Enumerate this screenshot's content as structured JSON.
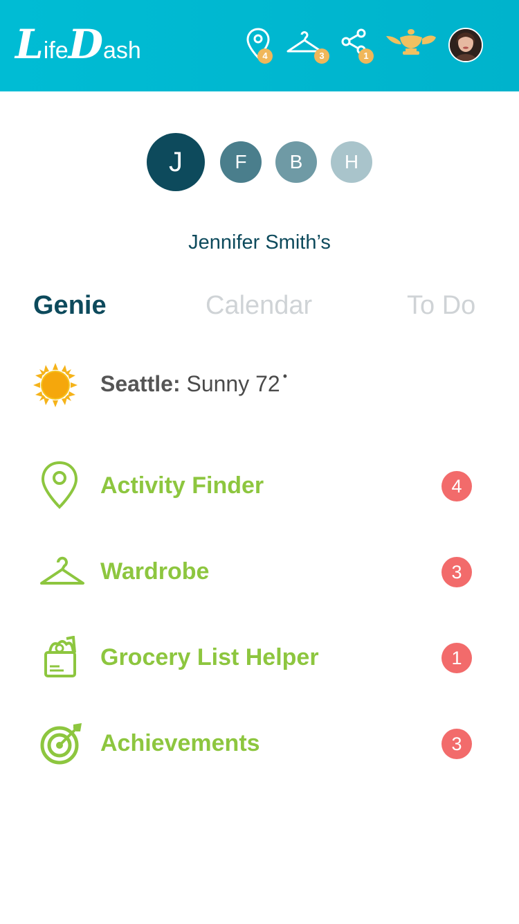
{
  "header": {
    "logo": {
      "big_l": "L",
      "life_rest": "ife",
      "big_d": "D",
      "dash_rest": "ash"
    },
    "icons": [
      {
        "name": "location-pin-icon",
        "badge": "4"
      },
      {
        "name": "hanger-icon",
        "badge": "3"
      },
      {
        "name": "share-icon",
        "badge": "1"
      },
      {
        "name": "genie-lamp-icon"
      },
      {
        "name": "user-avatar"
      }
    ],
    "colors": {
      "bar": "#00bcd4",
      "badge": "#f0b75a",
      "lamp": "#f0c060"
    }
  },
  "profiles": [
    {
      "initial": "J",
      "active": true,
      "color": "#0d4a5c"
    },
    {
      "initial": "F",
      "active": false,
      "color": "#4a7e8c"
    },
    {
      "initial": "B",
      "active": false,
      "color": "#6f9aa5"
    },
    {
      "initial": "H",
      "active": false,
      "color": "#a9c4cb"
    }
  ],
  "owner_label": "Jennifer Smith’s",
  "tabs": [
    {
      "label": "Genie",
      "active": true
    },
    {
      "label": "Calendar",
      "active": false
    },
    {
      "label": "To Do",
      "active": false
    }
  ],
  "weather": {
    "city": "Seattle:",
    "condition": "Sunny 72",
    "degree_mark": "•",
    "icon": "sun-icon"
  },
  "items": [
    {
      "label": "Activity Finder",
      "badge": "4",
      "icon": "location-pin-icon"
    },
    {
      "label": "Wardrobe",
      "badge": "3",
      "icon": "hanger-icon"
    },
    {
      "label": "Grocery List Helper",
      "badge": "1",
      "icon": "grocery-bag-icon"
    },
    {
      "label": "Achievements",
      "badge": "3",
      "icon": "target-icon"
    }
  ],
  "colors": {
    "accent_green": "#8dc63f",
    "badge_red": "#f26b6b",
    "dark_teal": "#0d4a5c",
    "tab_inactive": "#cfd3d6"
  }
}
